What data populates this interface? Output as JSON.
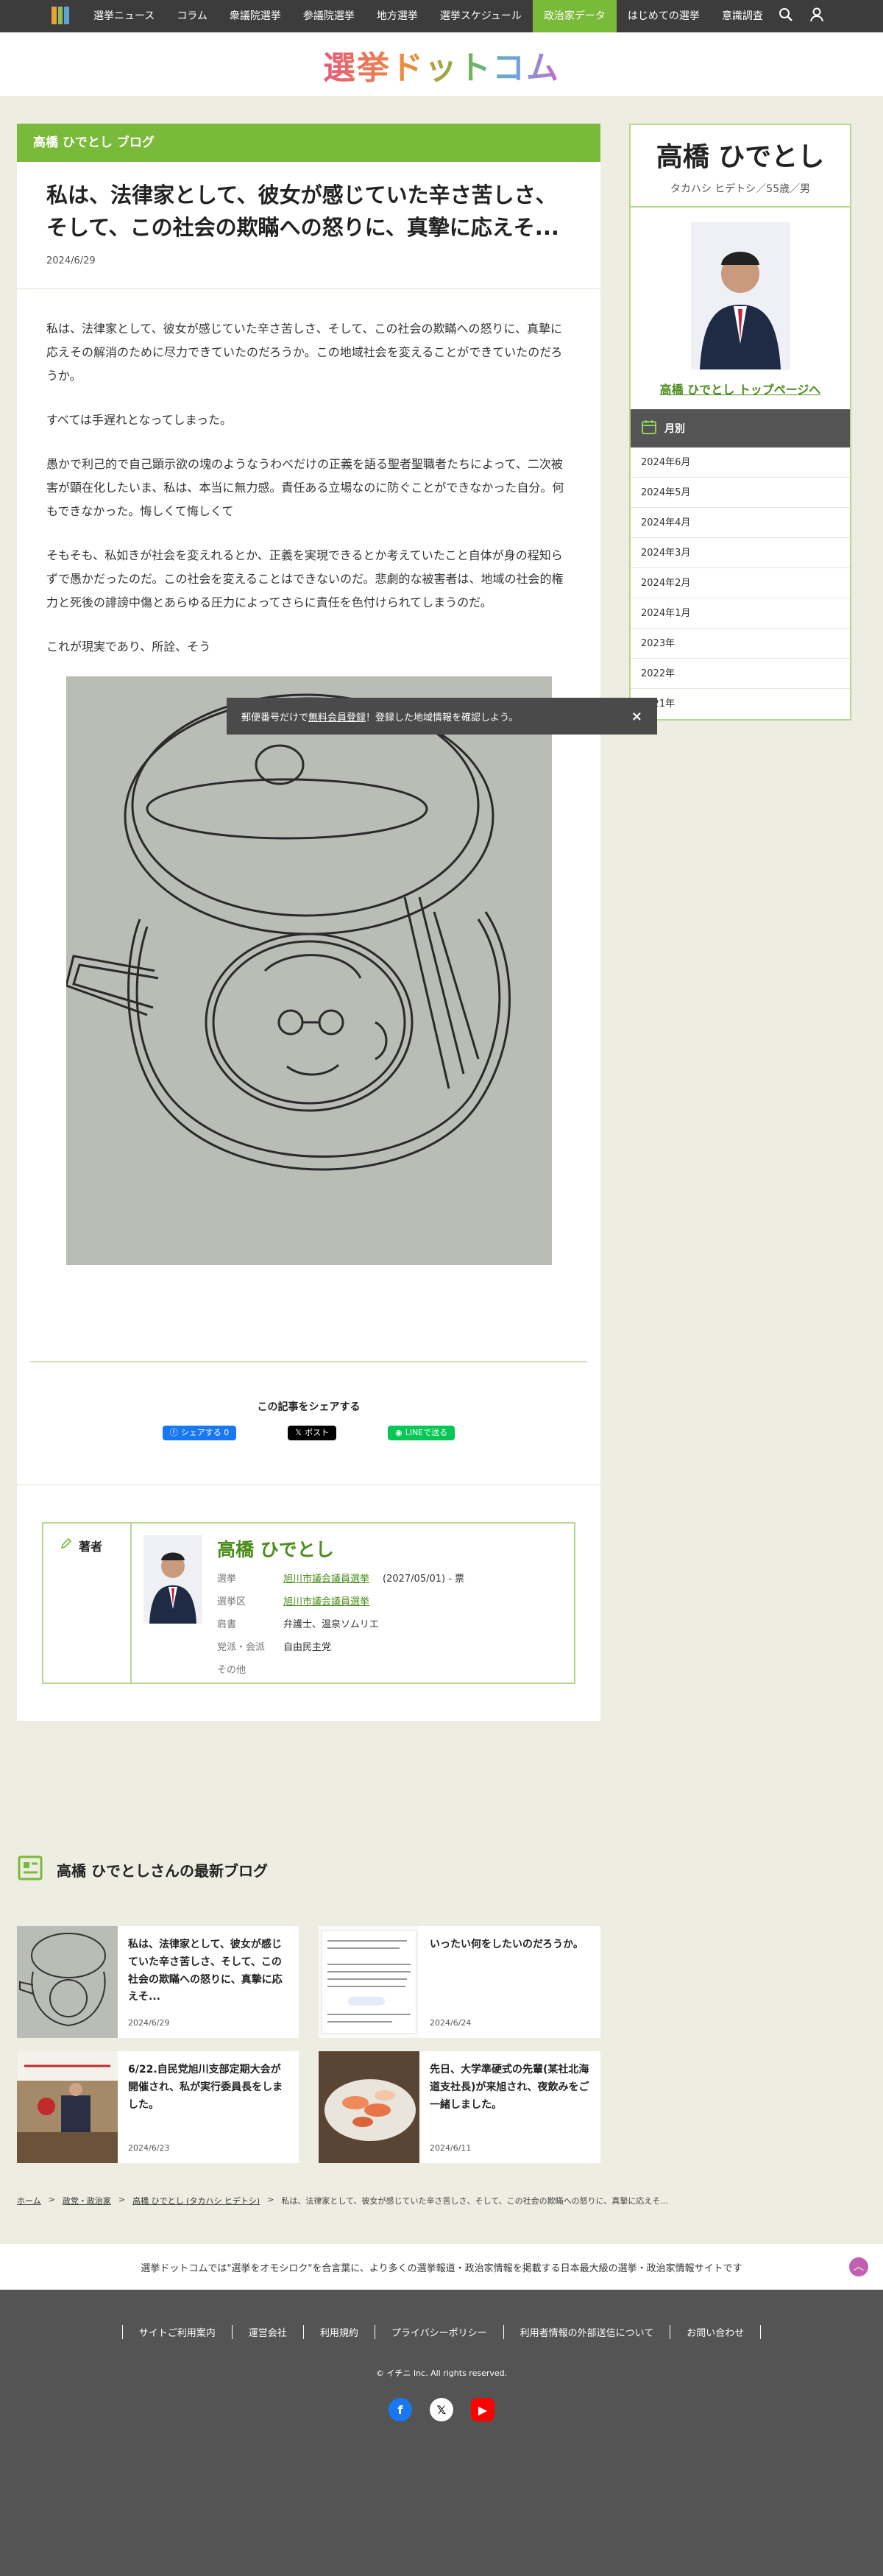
{
  "nav": {
    "items": [
      "選挙ニュース",
      "コラム",
      "衆議院選挙",
      "参議院選挙",
      "地方選挙",
      "選挙スケジュール",
      "政治家データ",
      "はじめての選挙",
      "意識調査"
    ],
    "active_index": 6
  },
  "logo": {
    "text": "選挙ドットコム"
  },
  "blog_bar": "高橋 ひでとし ブログ",
  "article": {
    "title": "私は、法律家として、彼女が感じていた辛さ苦しさ、そして、この社会の欺瞞への怒りに、真摯に応えそ...",
    "date": "2024/6/29",
    "paragraphs": [
      "私は、法律家として、彼女が感じていた辛さ苦しさ、そして、この社会の欺瞞への怒りに、真摯に応えその解消のために尽力できていたのだろうか。この地域社会を変えることができていたのだろうか。",
      "すべては手遅れとなってしまった。",
      "愚かで利己的で自己顕示欲の塊のようなうわべだけの正義を語る聖者聖職者たちによって、二次被害が顕在化したいま、私は、本当に無力感。責任ある立場なのに防ぐことができなかった自分。何もできなかった。悔しくて悔しくて",
      "そもそも、私如きが社会を変えれるとか、正義を実現できるとか考えていたこと自体が身の程知らずで愚かだったのだ。この社会を変えることはできないのだ。悲劇的な被害者は、地域の社会的権力と死後の誹謗中傷とあらゆる圧力によってさらに責任を色付けられてしまうのだ。",
      "これが現実であり、所詮、そう"
    ]
  },
  "toast": {
    "prefix": "郵便番号だけで",
    "link": "無料会員登録",
    "suffix": "！登録した地域情報を確認しよう。",
    "close": "×"
  },
  "share": {
    "heading": "この記事をシェアする",
    "facebook": "シェアする 0",
    "x": "ポスト",
    "line": "LINEで送る"
  },
  "author": {
    "label": "著者",
    "name": "高橋 ひでとし",
    "rows": [
      {
        "k": "選挙",
        "v": "旭川市議会議員選挙",
        "extra": "(2027/05/01) - 票"
      },
      {
        "k": "選挙区",
        "v": "旭川市議会議員選挙",
        "extra": ""
      },
      {
        "k": "肩書",
        "v": "弁護士、温泉ソムリエ",
        "extra": ""
      },
      {
        "k": "党派・会派",
        "v": "自由民主党",
        "extra": ""
      },
      {
        "k": "その他",
        "v": "",
        "extra": ""
      }
    ]
  },
  "sidebar": {
    "name": "高橋 ひでとし",
    "kana": "タカハシ ヒデトシ／55歳／男",
    "top_link": "高橋 ひでとし トップページへ",
    "month_heading": "月別",
    "months": [
      "2024年6月",
      "2024年5月",
      "2024年4月",
      "2024年3月",
      "2024年2月",
      "2024年1月",
      "2023年",
      "2022年",
      "2021年"
    ]
  },
  "latest": {
    "heading": "高橋 ひでとしさんの最新ブログ",
    "cards": [
      {
        "title": "私は、法律家として、彼女が感じていた辛さ苦しさ、そして、この社会の欺瞞への怒りに、真摯に応えそ...",
        "date": "2024/6/29"
      },
      {
        "title": "いったい何をしたいのだろうか。",
        "date": "2024/6/24"
      },
      {
        "title": "6/22.自民党旭川支部定期大会が開催され、私が実行委員長をしました。",
        "date": "2024/6/23"
      },
      {
        "title": "先日、大学準硬式の先輩(某社北海道支社長)が来旭され、夜飲みをご一緒しました。",
        "date": "2024/6/11"
      }
    ]
  },
  "breadcrumb": {
    "home": "ホーム",
    "parent": "政党・政治家",
    "person": "高橋 ひでとし (タカハシ ヒデトシ)",
    "current": "私は、法律家として、彼女が感じていた辛さ苦しさ、そして、この社会の欺瞞への怒りに、真摯に応えそ..."
  },
  "tagline": "選挙ドットコムでは\"選挙をオモシロク\"を合言葉に、より多くの選挙報道・政治家情報を掲載する日本最大級の選挙・政治家情報サイトです",
  "footer": {
    "links": [
      "サイトご利用案内",
      "運営会社",
      "利用規約",
      "プライバシーポリシー",
      "利用者情報の外部送信について",
      "お問い合わせ"
    ],
    "copyright": "© イチニ Inc. All rights reserved."
  },
  "colors": {
    "accent": "#7aba3a",
    "dark": "#3c3c3c",
    "bg": "#edede1"
  }
}
